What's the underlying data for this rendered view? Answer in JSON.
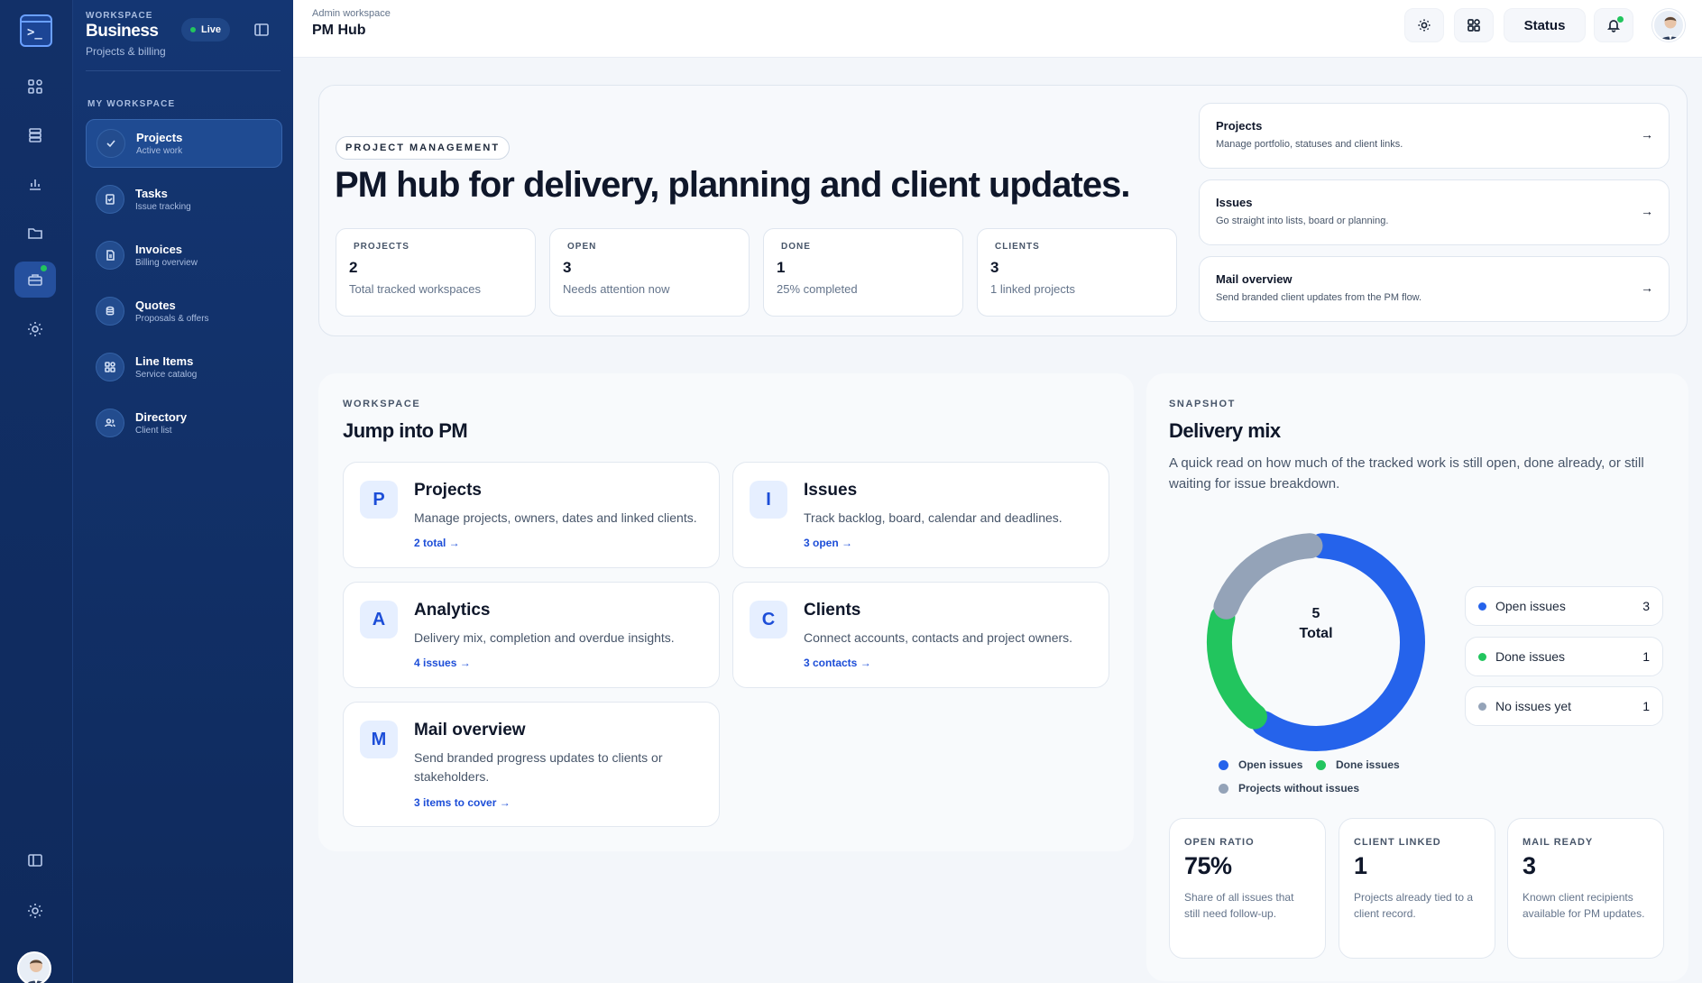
{
  "rail": {
    "icons": [
      "terminal-logo-icon",
      "dashboard-icon",
      "database-icon",
      "chart-icon",
      "folder-icon",
      "briefcase-icon",
      "sun-icon",
      "panel-icon",
      "settings-icon"
    ]
  },
  "sidebar": {
    "eyebrow": "WORKSPACE",
    "name": "Business",
    "subtitle": "Projects & billing",
    "live_label": "Live",
    "section_label": "MY WORKSPACE",
    "items": [
      {
        "label": "Projects",
        "sub": "Active work",
        "icon": "check-icon"
      },
      {
        "label": "Tasks",
        "sub": "Issue tracking",
        "icon": "clipboard-icon"
      },
      {
        "label": "Invoices",
        "sub": "Billing overview",
        "icon": "document-icon"
      },
      {
        "label": "Quotes",
        "sub": "Proposals & offers",
        "icon": "stack-icon"
      },
      {
        "label": "Line Items",
        "sub": "Service catalog",
        "icon": "grid-icon"
      },
      {
        "label": "Directory",
        "sub": "Client list",
        "icon": "users-icon"
      }
    ]
  },
  "topbar": {
    "breadcrumb": "Admin workspace",
    "title": "PM Hub",
    "status_label": "Status"
  },
  "hero": {
    "chip": "PROJECT MANAGEMENT",
    "title": "PM hub for delivery, planning and client updates.",
    "stats": [
      {
        "label": "PROJECTS",
        "value": "2",
        "note": "Total tracked workspaces"
      },
      {
        "label": "OPEN",
        "value": "3",
        "note": "Needs attention now"
      },
      {
        "label": "DONE",
        "value": "1",
        "note": "25% completed"
      },
      {
        "label": "CLIENTS",
        "value": "3",
        "note": "1 linked projects"
      }
    ],
    "links": [
      {
        "title": "Projects",
        "sub": "Manage portfolio, statuses and client links.",
        "arrow": "→"
      },
      {
        "title": "Issues",
        "sub": "Go straight into lists, board or planning.",
        "arrow": "→"
      },
      {
        "title": "Mail overview",
        "sub": "Send branded client updates from the PM flow.",
        "arrow": "→"
      }
    ]
  },
  "workspace": {
    "eyebrow": "WORKSPACE",
    "title": "Jump into PM",
    "cards": [
      {
        "letter": "P",
        "title": "Projects",
        "desc": "Manage projects, owners, dates and linked clients.",
        "link": "2 total →"
      },
      {
        "letter": "I",
        "title": "Issues",
        "desc": "Track backlog, board, calendar and deadlines.",
        "link": "3 open →"
      },
      {
        "letter": "A",
        "title": "Analytics",
        "desc": "Delivery mix, completion and overdue insights.",
        "link": "4 issues →"
      },
      {
        "letter": "C",
        "title": "Clients",
        "desc": "Connect accounts, contacts and project owners.",
        "link": "3 contacts →"
      },
      {
        "letter": "M",
        "title": "Mail overview",
        "desc": "Send branded progress updates to clients or stakeholders.",
        "link": "3 items to cover →"
      }
    ]
  },
  "snapshot": {
    "eyebrow": "SNAPSHOT",
    "title": "Delivery mix",
    "desc": "A quick read on how much of the tracked work is still open, done already, or still waiting for issue breakdown.",
    "total_value": "5",
    "total_label": "Total",
    "legend": [
      "Open issues",
      "Done issues",
      "Projects without issues"
    ],
    "counts": [
      {
        "label": "Open issues",
        "value": "3",
        "color": "#2563eb"
      },
      {
        "label": "Done issues",
        "value": "1",
        "color": "#22c55e"
      },
      {
        "label": "No issues yet",
        "value": "1",
        "color": "#94a3b8"
      }
    ],
    "metrics": [
      {
        "label": "OPEN RATIO",
        "value": "75%",
        "note": "Share of all issues that still need follow-up."
      },
      {
        "label": "CLIENT LINKED",
        "value": "1",
        "note": "Projects already tied to a client record."
      },
      {
        "label": "MAIL READY",
        "value": "3",
        "note": "Known client recipients available for PM updates."
      }
    ]
  },
  "chart_data": {
    "type": "pie",
    "categories": [
      "Open issues",
      "Done issues",
      "Projects without issues"
    ],
    "values": [
      3,
      1,
      1
    ],
    "colors": [
      "#2563eb",
      "#22c55e",
      "#94a3b8"
    ],
    "total": 5
  },
  "colors": {
    "accent": "#2563eb",
    "success": "#22c55e",
    "muted": "#94a3b8",
    "sidebar": "#143673"
  }
}
